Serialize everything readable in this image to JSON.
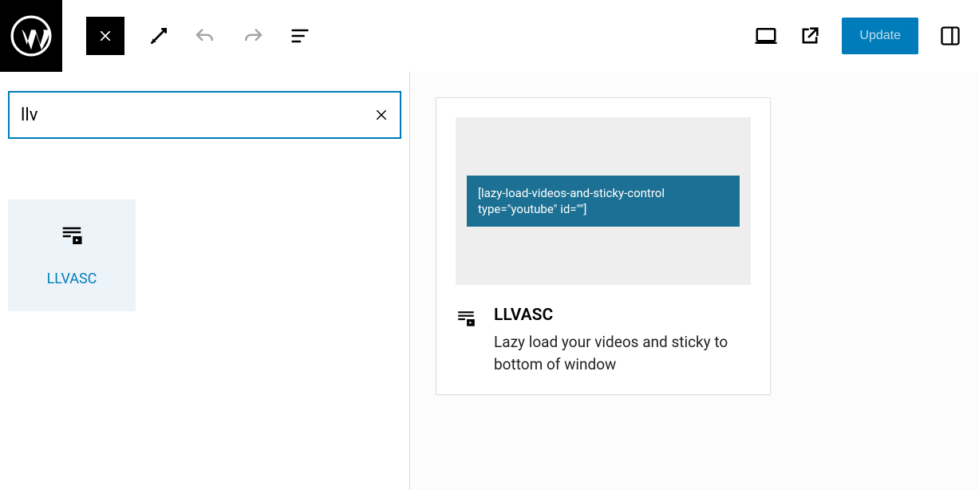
{
  "toolbar": {
    "update_label": "Update"
  },
  "inserter": {
    "search_value": "llv",
    "block": {
      "name": "LLVASC"
    }
  },
  "preview": {
    "shortcode": "[lazy-load-videos-and-sticky-control type=\"youtube\" id=\"\"]",
    "title": "LLVASC",
    "description": "Lazy load your videos and sticky to bottom of window"
  }
}
